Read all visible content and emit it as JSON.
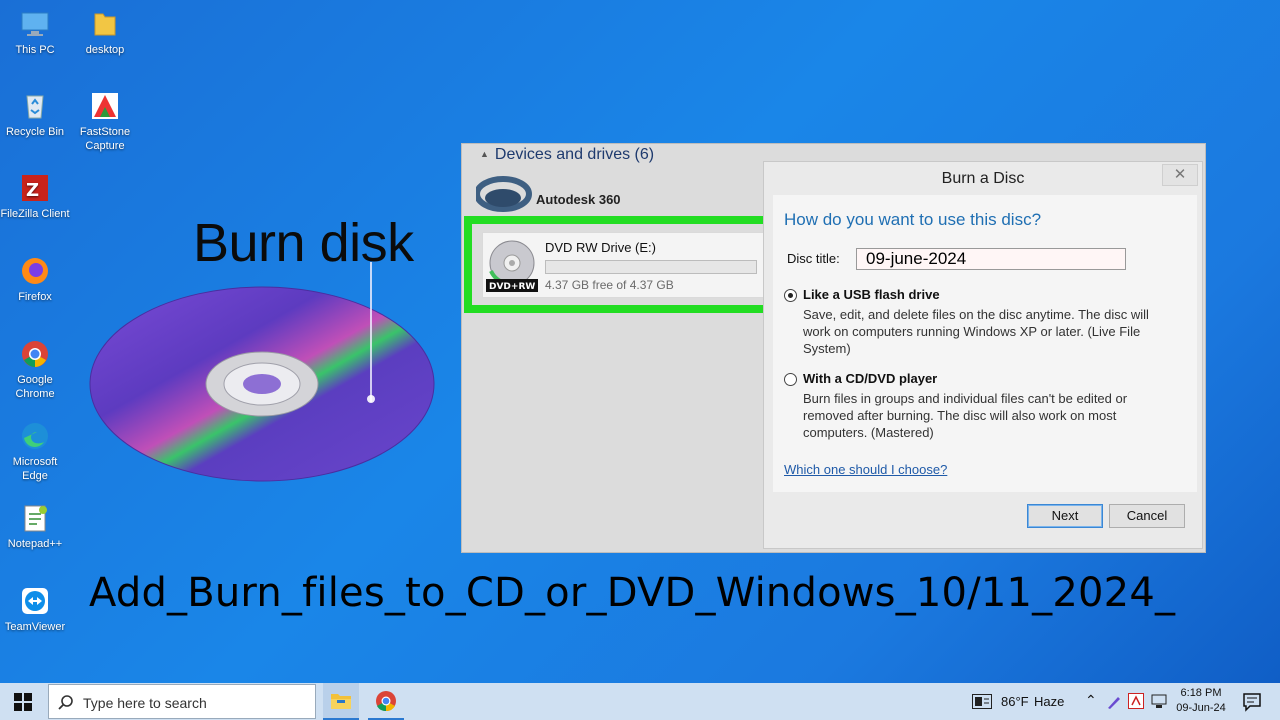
{
  "desktop": {
    "icons": [
      {
        "label": "This PC",
        "icon": "this-pc-icon"
      },
      {
        "label": "desktop",
        "icon": "folder-icon"
      },
      {
        "label": "Recycle Bin",
        "icon": "recycle-bin-icon"
      },
      {
        "label": "FastStone Capture",
        "icon": "faststone-icon"
      },
      {
        "label": "FileZilla Client",
        "icon": "filezilla-icon"
      },
      {
        "label": "Firefox",
        "icon": "firefox-icon"
      },
      {
        "label": "Google Chrome",
        "icon": "chrome-icon"
      },
      {
        "label": "Microsoft Edge",
        "icon": "edge-icon"
      },
      {
        "label": "Notepad++",
        "icon": "notepadpp-icon"
      },
      {
        "label": "TeamViewer",
        "icon": "teamviewer-icon"
      }
    ]
  },
  "overlay": {
    "title": "Burn disk",
    "caption": "Add_Burn_files_to_CD_or_DVD_Windows_10/11_2024_"
  },
  "explorer": {
    "devices_header": "Devices and drives (6)",
    "autodesk_label": "Autodesk 360",
    "drive": {
      "name": "DVD RW Drive (E:)",
      "badge": "DVD+RW",
      "free_text": "4.37 GB free of 4.37 GB",
      "used_fraction": 0
    },
    "highlight_color": "#22dd22"
  },
  "dialog": {
    "title": "Burn a Disc",
    "close_glyph": "✕",
    "question": "How do you want to use this disc?",
    "disc_title_label": "Disc title:",
    "disc_title_value": "09-june-2024",
    "option_usb": {
      "heading": "Like a USB flash drive",
      "description": "Save, edit, and delete files on the disc anytime. The disc will work on computers running Windows XP or later. (Live File System)",
      "selected": true
    },
    "option_cd": {
      "heading": "With a CD/DVD player",
      "description": "Burn files in groups and individual files can't be edited or removed after burning. The disc will also work on most computers. (Mastered)",
      "selected": false
    },
    "help_link": "Which one should I choose?",
    "next_label": "Next",
    "cancel_label": "Cancel"
  },
  "taskbar": {
    "search_placeholder": "Type here to search",
    "weather_temp": "86°F",
    "weather_desc": "Haze",
    "time": "6:18 PM",
    "date": "09-Jun-24",
    "accent": "#cfe0f2"
  }
}
